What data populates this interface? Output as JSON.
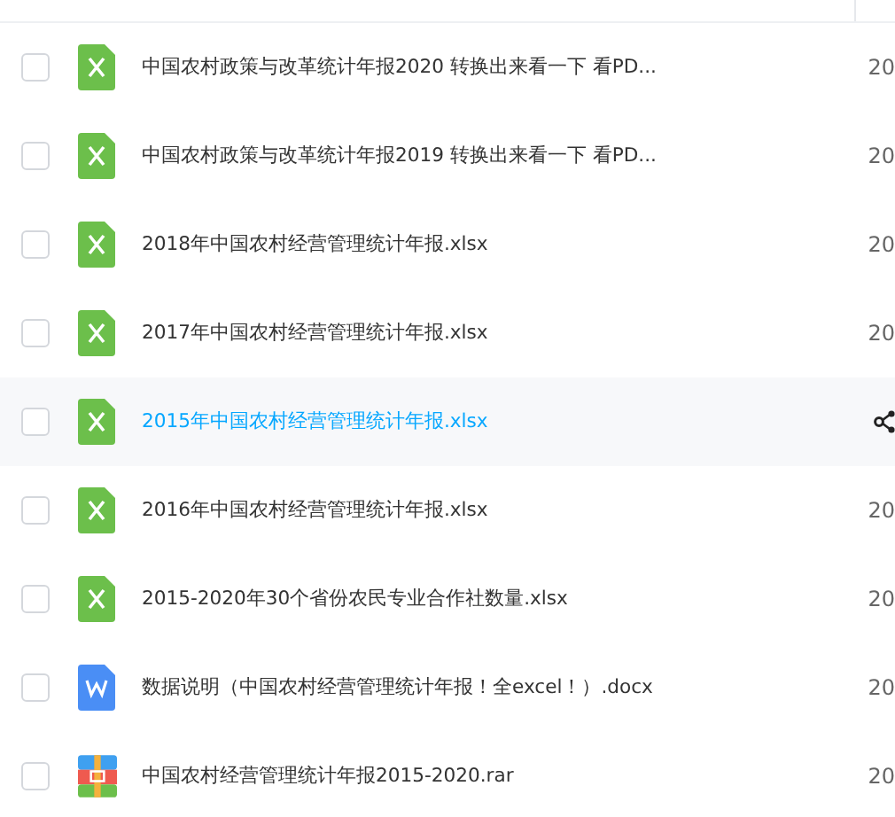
{
  "files": [
    {
      "name": "中国农村政策与改革统计年报2020 转换出来看一下 看PD...",
      "kind": "excel",
      "checked": false,
      "hovered": false,
      "date": "20"
    },
    {
      "name": "中国农村政策与改革统计年报2019 转换出来看一下 看PD...",
      "kind": "excel",
      "checked": false,
      "hovered": false,
      "date": "20"
    },
    {
      "name": "2018年中国农村经营管理统计年报.xlsx",
      "kind": "excel",
      "checked": false,
      "hovered": false,
      "date": "20"
    },
    {
      "name": "2017年中国农村经营管理统计年报.xlsx",
      "kind": "excel",
      "checked": false,
      "hovered": false,
      "date": "20"
    },
    {
      "name": "2015年中国农村经营管理统计年报.xlsx",
      "kind": "excel",
      "checked": false,
      "hovered": true
    },
    {
      "name": "2016年中国农村经营管理统计年报.xlsx",
      "kind": "excel",
      "checked": false,
      "hovered": false,
      "date": "20"
    },
    {
      "name": "2015-2020年30个省份农民专业合作社数量.xlsx",
      "kind": "excel",
      "checked": false,
      "hovered": false,
      "date": "20"
    },
    {
      "name": "数据说明（中国农村经营管理统计年报！全excel！）.docx",
      "kind": "word",
      "checked": false,
      "hovered": false,
      "date": "20"
    },
    {
      "name": "中国农村经营管理统计年报2015-2020.rar",
      "kind": "rar",
      "checked": false,
      "hovered": false,
      "date": "20"
    }
  ]
}
